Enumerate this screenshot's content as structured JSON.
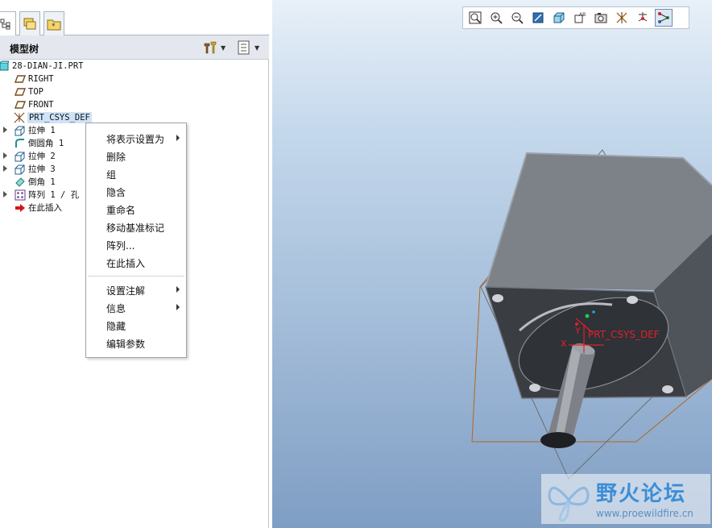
{
  "panel": {
    "tabs": [
      "model-tree-tab",
      "layers-tab",
      "favorites-tab"
    ],
    "title": "模型树"
  },
  "tree": {
    "items": [
      {
        "label": "28-DIAN-JI.PRT",
        "icon": "part-icon",
        "expandable": false
      },
      {
        "label": "RIGHT",
        "icon": "datum-plane-icon",
        "expandable": false
      },
      {
        "label": "TOP",
        "icon": "datum-plane-icon",
        "expandable": false
      },
      {
        "label": "FRONT",
        "icon": "datum-plane-icon",
        "expandable": false
      },
      {
        "label": "PRT_CSYS_DEF",
        "icon": "csys-icon",
        "expandable": false,
        "selected": true
      },
      {
        "label": "拉伸 1",
        "icon": "extrude-icon",
        "expandable": true
      },
      {
        "label": "倒圆角 1",
        "icon": "round-icon",
        "expandable": false
      },
      {
        "label": "拉伸 2",
        "icon": "extrude-icon",
        "expandable": true
      },
      {
        "label": "拉伸 3",
        "icon": "extrude-icon",
        "expandable": true
      },
      {
        "label": "倒角 1",
        "icon": "chamfer-icon",
        "expandable": false
      },
      {
        "label": "阵列 1 / 孔",
        "icon": "pattern-icon",
        "expandable": true
      },
      {
        "label": "在此插入",
        "icon": "insert-here-arrow-icon",
        "expandable": false
      }
    ]
  },
  "context_menu": {
    "group1": [
      {
        "label": "将表示设置为",
        "submenu": true
      },
      {
        "label": "删除",
        "submenu": false
      },
      {
        "label": "组",
        "submenu": false
      },
      {
        "label": "隐含",
        "submenu": false
      },
      {
        "label": "重命名",
        "submenu": false
      },
      {
        "label": "移动基准标记",
        "submenu": false
      },
      {
        "label": "阵列...",
        "submenu": false
      },
      {
        "label": "在此插入",
        "submenu": false
      }
    ],
    "group2": [
      {
        "label": "设置注解",
        "submenu": true
      },
      {
        "label": "信息",
        "submenu": true
      },
      {
        "label": "隐藏",
        "submenu": false
      },
      {
        "label": "编辑参数",
        "submenu": false
      }
    ]
  },
  "view_toolbar": {
    "buttons": [
      "refit-icon",
      "zoom-in-icon",
      "zoom-out-icon",
      "repaint-icon",
      "display-style-icon",
      "annotation-display-icon",
      "saved-views-icon",
      "datum-display-icon",
      "spin-center-icon",
      "model-tree-display-icon"
    ]
  },
  "viewport": {
    "csys_label": "PRT_CSYS_DEF",
    "axis_x_label": "X",
    "axis_y_label": "Y"
  },
  "watermark": {
    "title": "野火论坛",
    "url": "www.proewildfire.cn"
  }
}
